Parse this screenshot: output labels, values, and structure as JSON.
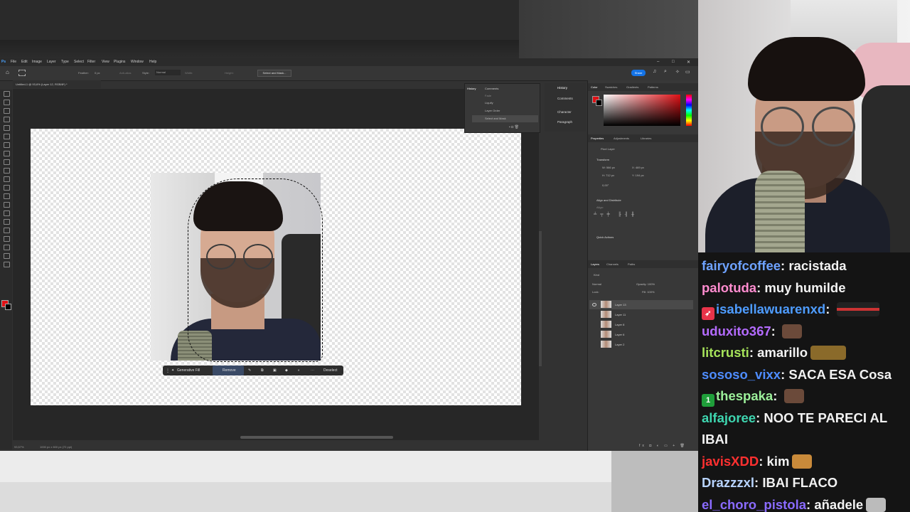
{
  "photoshop": {
    "menu": [
      "File",
      "Edit",
      "Image",
      "Layer",
      "Type",
      "Select",
      "Filter",
      "View",
      "Plugins",
      "Window",
      "Help"
    ],
    "options": {
      "feather_label": "Feather:",
      "feather_value": "0 px",
      "antialias": "Anti-alias",
      "style_label": "Style:",
      "style_value": "Normal",
      "width": "Width:",
      "height": "Height:",
      "select_mask": "Select and Mask...",
      "share": "Share"
    },
    "doc_tab": "Untitled-1 @ 93,6% (Layer 12, RGB/8*) *",
    "context_bar": {
      "generative_fill": "Generative Fill",
      "remove": "Remove",
      "deselect": "Deselect"
    },
    "status": {
      "zoom": "93,57%",
      "doc": "1000 px x 600 px (72 ppi)"
    },
    "history_panel": {
      "tabs": [
        "History",
        "Comments"
      ],
      "rows": [
        "Fade",
        "Liquify",
        "Layer Order",
        "Select and Mask"
      ]
    },
    "dock": [
      "History",
      "Comments",
      "Character",
      "Paragraph"
    ],
    "color_tabs": [
      "Color",
      "Swatches",
      "Gradients",
      "Patterns"
    ],
    "properties": {
      "tabs": [
        "Properties",
        "Adjustments",
        "Libraries"
      ],
      "kind": "Pixel Layer",
      "transform": "Transform",
      "w": "W: 566 px",
      "h": "H: 712 px",
      "x": "X: 469 px",
      "y": "Y: 194 px",
      "angle": "0,00°",
      "align": "Align and Distribute",
      "align_sub": "Align:",
      "quick_actions": "Quick Actions"
    },
    "layers": {
      "tabs": [
        "Layers",
        "Channels",
        "Paths"
      ],
      "filter": "Kind",
      "blend": "Normal",
      "opacity": "Opacity: 100%",
      "fill": "Fill: 100%",
      "lock": "Lock:",
      "items": [
        "Layer 13",
        "Layer 11",
        "Layer 8",
        "Layer 6",
        "Layer 2"
      ]
    }
  },
  "chat": [
    {
      "user": "fairyofcoffee",
      "color": "#6ea2ff",
      "text": "racistada",
      "badge": "",
      "emote": false
    },
    {
      "user": "palotuda",
      "color": "#ff8ccf",
      "text": "muy humilde",
      "badge": "",
      "emote": false
    },
    {
      "user": "isabellawuarenxd",
      "color": "#4e9cff",
      "text": "",
      "badge": "rocket-badge",
      "emote": true
    },
    {
      "user": "uduxito367",
      "color": "#b46bff",
      "text": "",
      "badge": "",
      "emote": true
    },
    {
      "user": "litcrusti",
      "color": "#a6e35a",
      "text": "amarillo",
      "badge": "",
      "emote": true
    },
    {
      "user": "sososo_vixx",
      "color": "#4e8cff",
      "text": "SACA ESA Cosa",
      "badge": "",
      "emote": false
    },
    {
      "user": "thespaka",
      "color": "#9cf09a",
      "text": "",
      "badge": "first-badge",
      "emote": true
    },
    {
      "user": "alfajoree",
      "color": "#3ed6b0",
      "text": "NOO TE PARECI AL",
      "badge": "",
      "emote": false
    },
    {
      "user": "",
      "color": "#ffffff",
      "text": "IBAI",
      "badge": "",
      "emote": false
    },
    {
      "user": "javisXDD",
      "color": "#ff3030",
      "text": "kim",
      "badge": "",
      "emote": true
    },
    {
      "user": "Drazzzxl",
      "color": "#b8d4ff",
      "text": "IBAI FLACO",
      "badge": "",
      "emote": false
    },
    {
      "user": "el_choro_pistola",
      "color": "#8a6bff",
      "text": "añadele",
      "badge": "",
      "emote": true
    }
  ]
}
